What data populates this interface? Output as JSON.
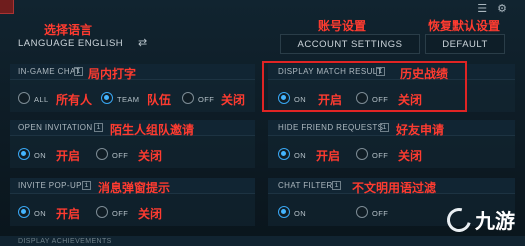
{
  "annotations": {
    "select_language": "选择语言",
    "account_settings": "账号设置",
    "restore_defaults": "恢复默认设置",
    "ingame_chat": "局内打字",
    "everyone": "所有人",
    "team": "队伍",
    "off_1": "关闭",
    "match_history": "历史战绩",
    "on_1": "开启",
    "off_2": "关闭",
    "stranger_invites": "陌生人组队邀请",
    "friend_requests": "好友申请",
    "on_2": "开启",
    "off_3": "关闭",
    "on_3": "开启",
    "off_4": "关闭",
    "popup_prompt": "消息弹窗提示",
    "on_4": "开启",
    "off_5": "关闭",
    "chat_filter_partial": "不文明用语过滤"
  },
  "top": {
    "language": "LANGUAGE ENGLISH",
    "swap_icon": "⇄",
    "account_settings_btn": "ACCOUNT SETTINGS",
    "default_btn": "DEFAULT",
    "icon_1": "☰",
    "icon_2": "⚙"
  },
  "panels": {
    "ingame_chat": {
      "title": "IN-GAME CHAT",
      "options": [
        "ALL",
        "TEAM",
        "OFF"
      ],
      "selected": "TEAM"
    },
    "display_match_result": {
      "title": "DISPLAY MATCH RESULT",
      "options": [
        "ON",
        "OFF"
      ],
      "selected": "ON"
    },
    "open_invitation": {
      "title": "OPEN INVITATION",
      "options": [
        "ON",
        "OFF"
      ],
      "selected": "ON"
    },
    "hide_friend_requests": {
      "title": "HIDE FRIEND REQUESTS",
      "options": [
        "ON",
        "OFF"
      ],
      "selected": "ON"
    },
    "invite_popup": {
      "title": "INVITE POP-UP",
      "options": [
        "ON",
        "OFF"
      ],
      "selected": "ON"
    },
    "chat_filter": {
      "title": "CHAT FILTER",
      "options": [
        "ON",
        "OFF"
      ],
      "selected": "ON"
    }
  },
  "bottom": {
    "partial": "DISPLAY ACHIEVEMENTS"
  },
  "watermark": {
    "text": "九游"
  },
  "colors": {
    "accent": "#45b5ff",
    "annotation": "#ff3b30",
    "bg": "#0b1820"
  }
}
